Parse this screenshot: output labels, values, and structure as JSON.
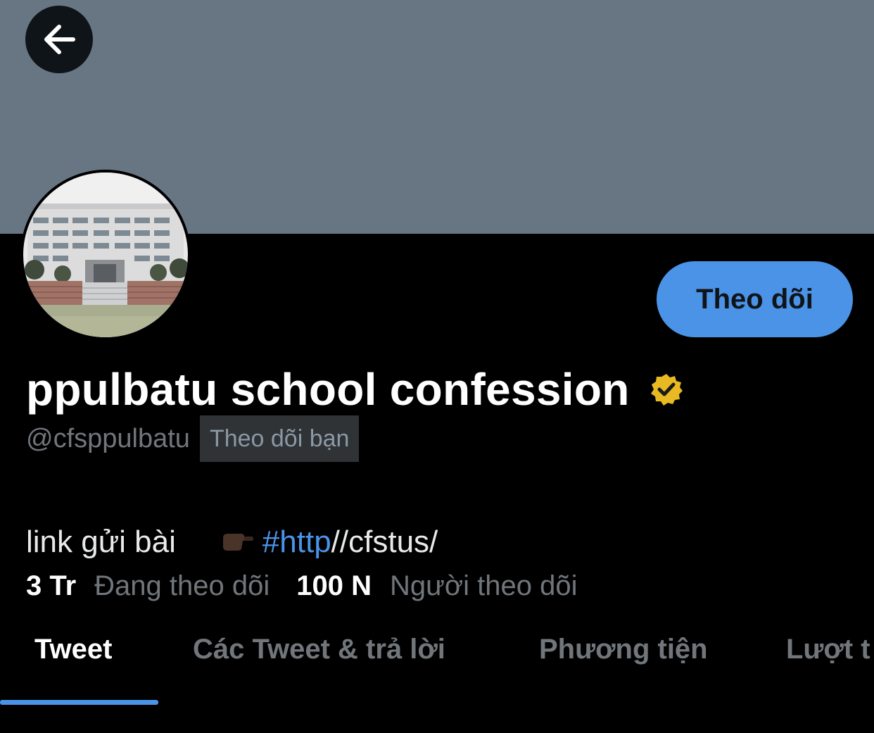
{
  "header": {
    "back_icon": "arrow-left-icon"
  },
  "profile": {
    "display_name": "ppulbatu school confession",
    "verified_icon": "verified-badge-icon",
    "verified_color": "#e8b923",
    "handle": "@cfsppulbatu",
    "follows_you_label": "Theo dõi bạn",
    "follow_button_label": "Theo dõi",
    "bio": {
      "text": "link gửi bài",
      "emoji": "pointing-hand-emoji",
      "hashtag": "#http",
      "link_suffix": "//cfstus/"
    }
  },
  "stats": {
    "following_count": "3 Tr",
    "following_label": "Đang theo dõi",
    "followers_count": "100 N",
    "followers_label": "Người theo dõi"
  },
  "tabs": [
    {
      "label": "Tweet",
      "active": true
    },
    {
      "label": "Các Tweet & trả lời",
      "active": false
    },
    {
      "label": "Phương tiện",
      "active": false
    },
    {
      "label": "Lượt t",
      "active": false
    }
  ],
  "colors": {
    "banner": "#687684",
    "accent": "#4a93e6",
    "background": "#000000"
  }
}
